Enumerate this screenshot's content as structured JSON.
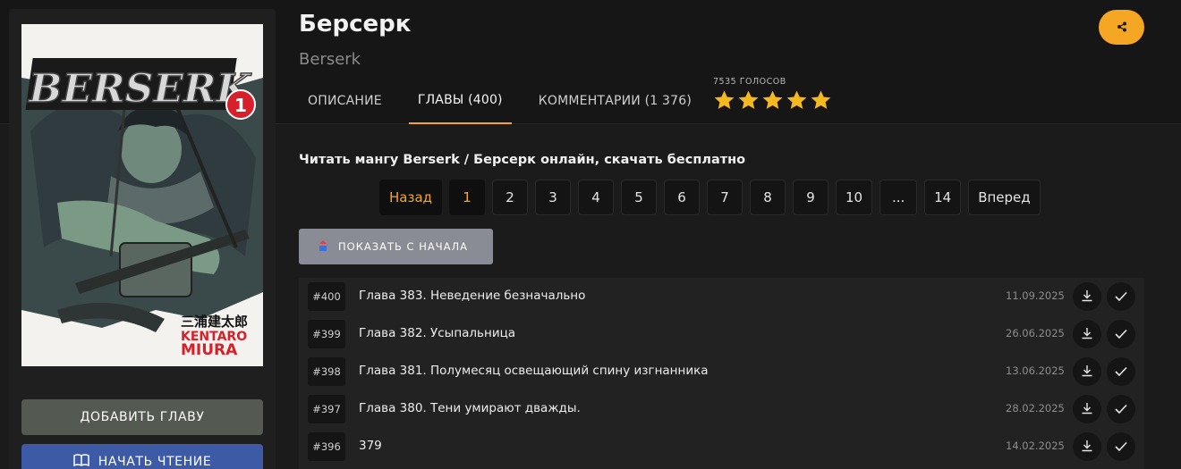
{
  "manga": {
    "title": "Берсерк",
    "subtitle": "Berserk",
    "cover": {
      "logo_text": "BERSERK",
      "volume": "1",
      "author_jp": "三浦建太郎",
      "author_en_1": "KENTARO",
      "author_en_2": "MIURA"
    }
  },
  "sidebar": {
    "add_chapter_label": "ДОБАВИТЬ ГЛАВУ",
    "start_reading_label": "НАЧАТЬ ЧТЕНИЕ"
  },
  "tabs": [
    {
      "label": "ОПИСАНИЕ",
      "active": false
    },
    {
      "label": "ГЛАВЫ (400)",
      "active": true
    },
    {
      "label": "КОММЕНТАРИИ (1 376)",
      "active": false
    }
  ],
  "rating": {
    "votes_label": "7535 ГОЛОСОВ",
    "stars": 5,
    "star_color": "#f5b81f"
  },
  "share_icon": "share-icon",
  "accent_color": "#f5a623",
  "main": {
    "heading": "Читать мангу Berserk / Берсерк онлайн, скачать бесплатно",
    "show_from_start_label": "ПОКАЗАТЬ С НАЧАЛА"
  },
  "pagination": {
    "prev_label": "Назад",
    "next_label": "Вперед",
    "pages": [
      "1",
      "2",
      "3",
      "4",
      "5",
      "6",
      "7",
      "8",
      "9",
      "10",
      "...",
      "14"
    ],
    "current": "1"
  },
  "chapters": [
    {
      "num": "#400",
      "title": "Глава 383. Неведение безначально",
      "date": "11.09.2025"
    },
    {
      "num": "#399",
      "title": "Глава 382. Усыпальница",
      "date": "26.06.2025"
    },
    {
      "num": "#398",
      "title": "Глава 381. Полумесяц освещающий спину изгнанника",
      "date": "13.06.2025"
    },
    {
      "num": "#397",
      "title": "Глава 380. Тени умирают дважды.",
      "date": "28.02.2025"
    },
    {
      "num": "#396",
      "title": "379",
      "date": "14.02.2025"
    }
  ]
}
